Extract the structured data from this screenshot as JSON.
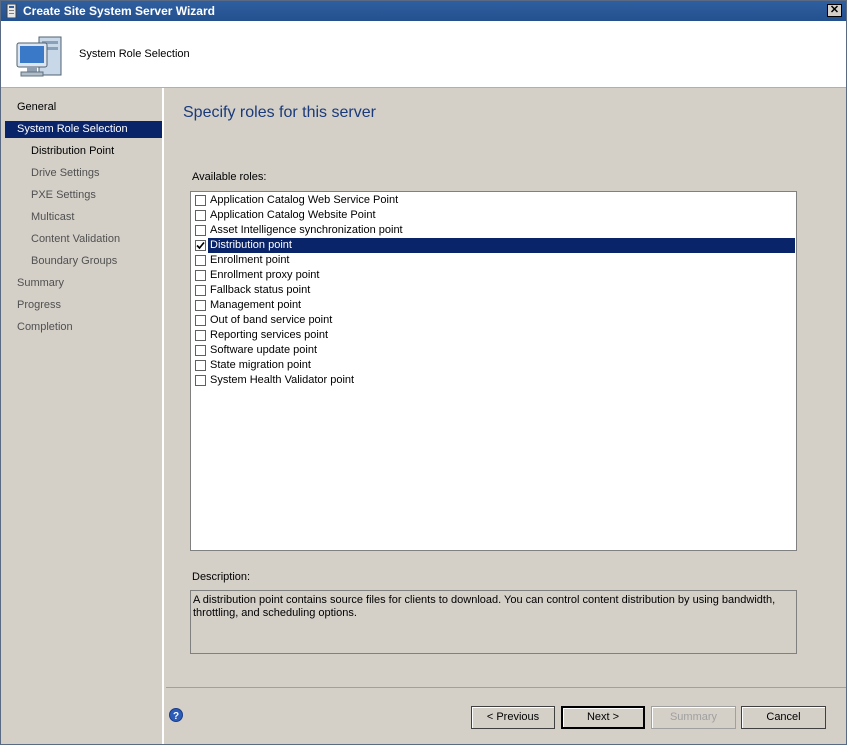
{
  "window": {
    "title": "Create Site System Server Wizard",
    "close_label": "✕"
  },
  "header": {
    "page_name": "System Role Selection"
  },
  "sidebar": {
    "items": [
      {
        "label": "General"
      },
      {
        "label": "System Role Selection"
      },
      {
        "label": "Distribution Point"
      },
      {
        "label": "Drive Settings"
      },
      {
        "label": "PXE Settings"
      },
      {
        "label": "Multicast"
      },
      {
        "label": "Content Validation"
      },
      {
        "label": "Boundary Groups"
      },
      {
        "label": "Summary"
      },
      {
        "label": "Progress"
      },
      {
        "label": "Completion"
      }
    ],
    "selected": "System Role Selection"
  },
  "main": {
    "title": "Specify roles for this server",
    "available_label": "Available roles:",
    "roles": [
      {
        "label": "Application Catalog Web Service Point",
        "checked": false
      },
      {
        "label": "Application Catalog Website Point",
        "checked": false
      },
      {
        "label": "Asset Intelligence synchronization point",
        "checked": false
      },
      {
        "label": "Distribution point",
        "checked": true
      },
      {
        "label": "Enrollment point",
        "checked": false
      },
      {
        "label": "Enrollment proxy point",
        "checked": false
      },
      {
        "label": "Fallback status point",
        "checked": false
      },
      {
        "label": "Management point",
        "checked": false
      },
      {
        "label": "Out of band service point",
        "checked": false
      },
      {
        "label": "Reporting services point",
        "checked": false
      },
      {
        "label": "Software update point",
        "checked": false
      },
      {
        "label": "State migration point",
        "checked": false
      },
      {
        "label": "System Health Validator point",
        "checked": false
      }
    ],
    "selected_role": "Distribution point",
    "description_label": "Description:",
    "description": "A distribution point contains source files for clients to download. You can control content distribution by using bandwidth, throttling, and scheduling options."
  },
  "footer": {
    "previous_label": "< Previous",
    "next_label": "Next >",
    "summary_label": "Summary",
    "cancel_label": "Cancel"
  },
  "colors": {
    "selection": "#0a246a",
    "title_bar": "#2f5fa0",
    "heading": "#1a3a7a"
  }
}
